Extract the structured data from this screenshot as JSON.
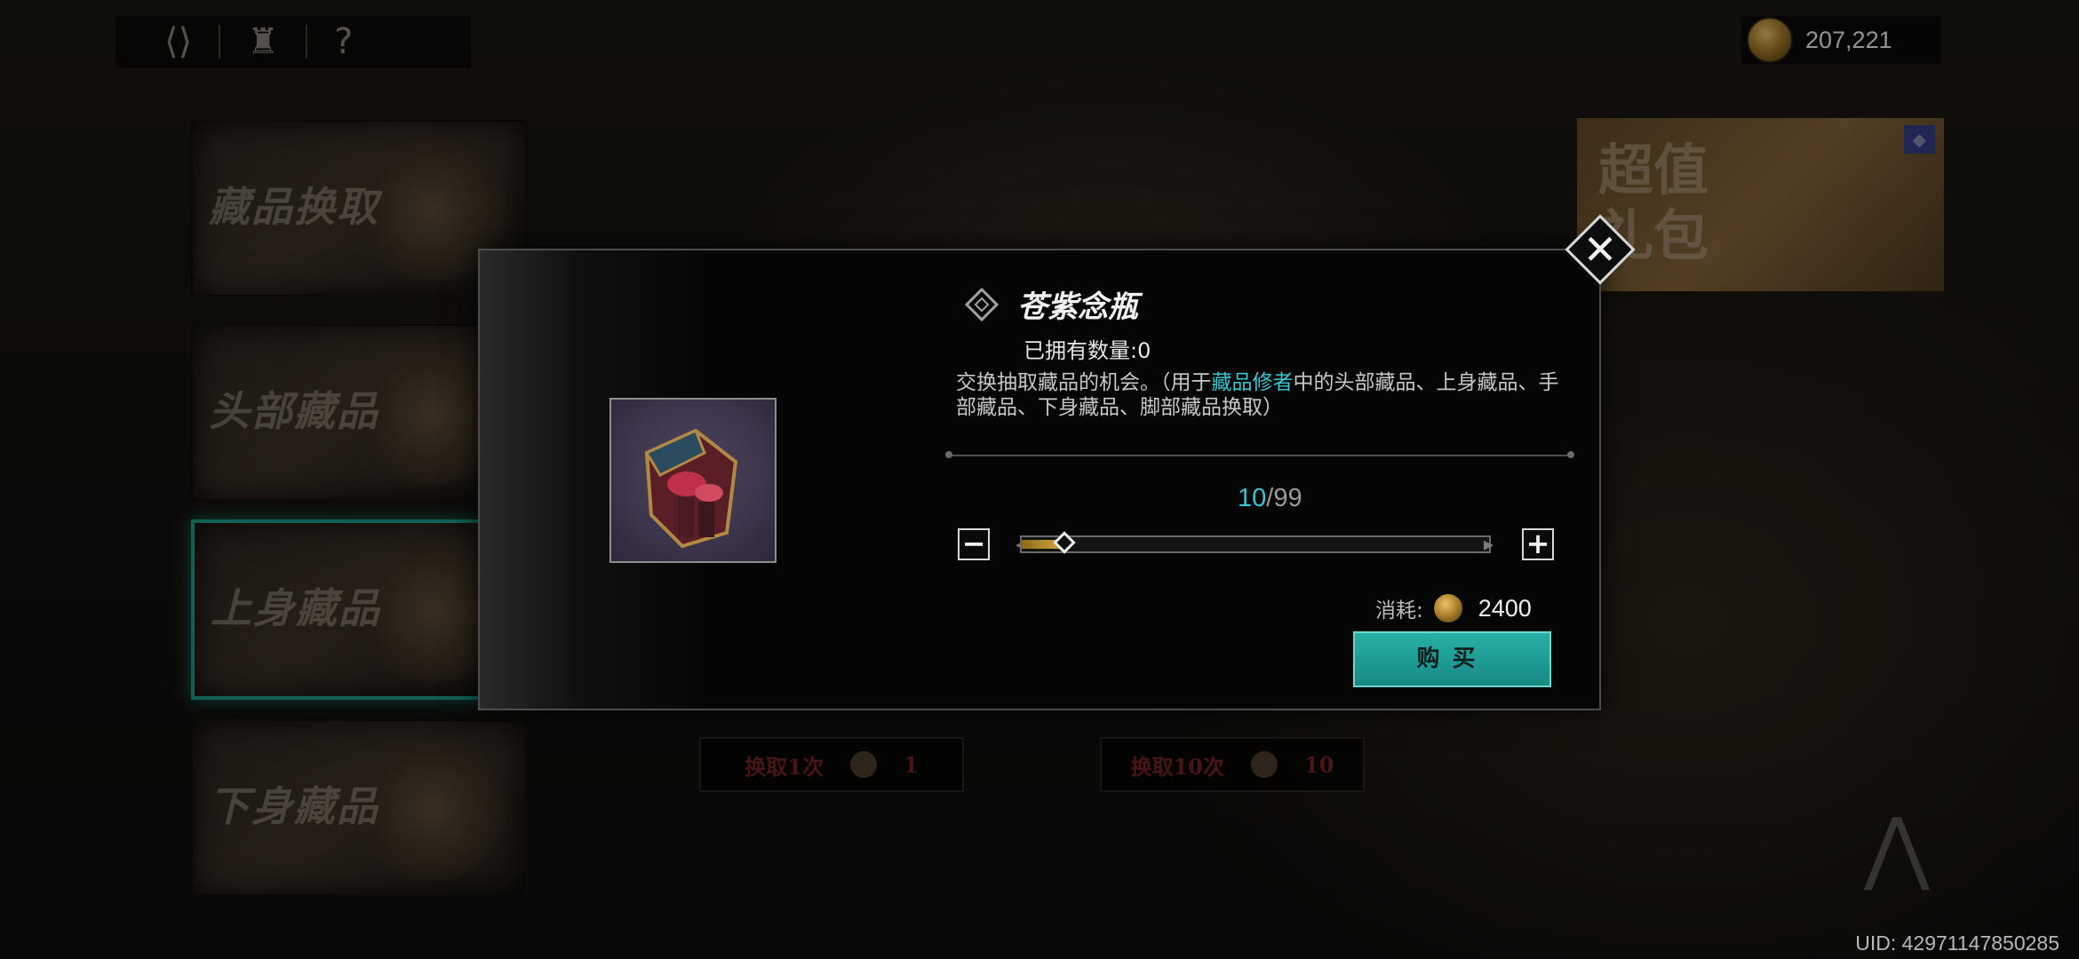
{
  "topbar": {
    "back_icon": "back-arrow-icon",
    "character_icon": "character-icon",
    "help_label": "?"
  },
  "categories": [
    {
      "label": "藏品换取",
      "active": false
    },
    {
      "label": "头部藏品",
      "active": false
    },
    {
      "label": "上身藏品",
      "active": true
    },
    {
      "label": "下身藏品",
      "active": false
    }
  ],
  "currency": {
    "amount": "207,221",
    "icon": "coin-icon"
  },
  "promo": {
    "line1": "超值",
    "line2": "礼包"
  },
  "background_buttons": {
    "draw_once": {
      "label": "换取1次",
      "count": "1"
    },
    "draw_ten": {
      "label": "换取10次",
      "count": "10"
    }
  },
  "uid": "UID: 42971147850285",
  "modal": {
    "item_name": "苍紫念瓶",
    "owned_label": "已拥有数量:0",
    "desc_before": "交换抽取藏品的机会。（用于",
    "desc_highlight": "藏品修者",
    "desc_after": "中的头部藏品、上身藏品、手部藏品、下身藏品、脚部藏品换取）",
    "quantity_current": "10",
    "quantity_max": "/99",
    "slider_fraction": 0.0909,
    "minus_label": "−",
    "plus_label": "+",
    "cost_label": "消耗:",
    "cost_value": "2400",
    "buy_label": "购买",
    "close_label": "✕"
  },
  "colors": {
    "accent_teal": "#38c7d1",
    "buy_button": "#1f9e96",
    "slider_gold": "#d9a93d"
  }
}
